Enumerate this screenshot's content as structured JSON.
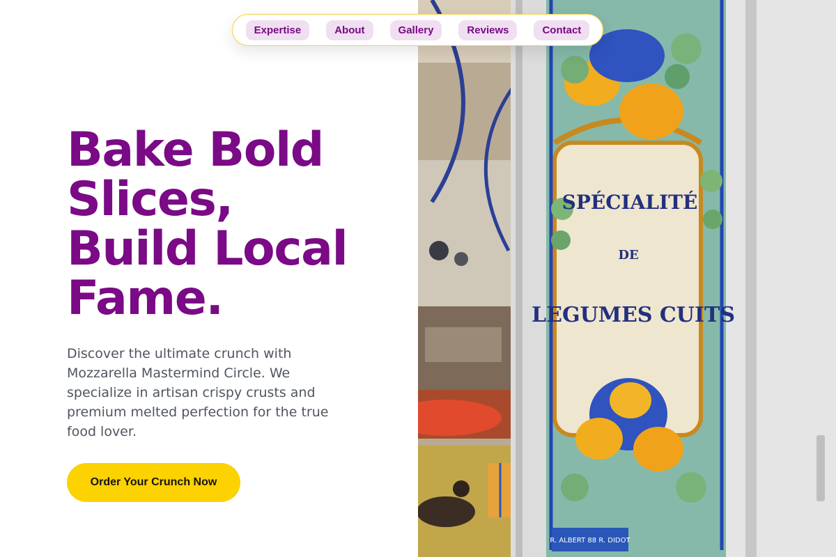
{
  "nav": {
    "items": [
      {
        "label": "Expertise"
      },
      {
        "label": "About"
      },
      {
        "label": "Gallery"
      },
      {
        "label": "Reviews"
      },
      {
        "label": "Contact"
      }
    ]
  },
  "hero": {
    "headline_lines": [
      "Bake Bold",
      "Slices,",
      "Build Local",
      "Fame."
    ],
    "description": "Discover the ultimate crunch with Mozzarella Mastermind Circle. We specialize in artisan crispy crusts and premium melted perfection for the true food lover.",
    "cta_label": "Order Your Crunch Now"
  },
  "photo": {
    "sign_lines": [
      "SPÉCIALITÉ",
      "DE",
      "LEGUMES CUITS"
    ],
    "sign_footer": "R. ALBERT 88 R. DIDOT"
  },
  "colors": {
    "headline": "#7a0a85",
    "body_text": "#4f5560",
    "cta_background": "#fcd200",
    "nav_pill_background": "#f0dff1",
    "nav_border": "#f1d548"
  }
}
